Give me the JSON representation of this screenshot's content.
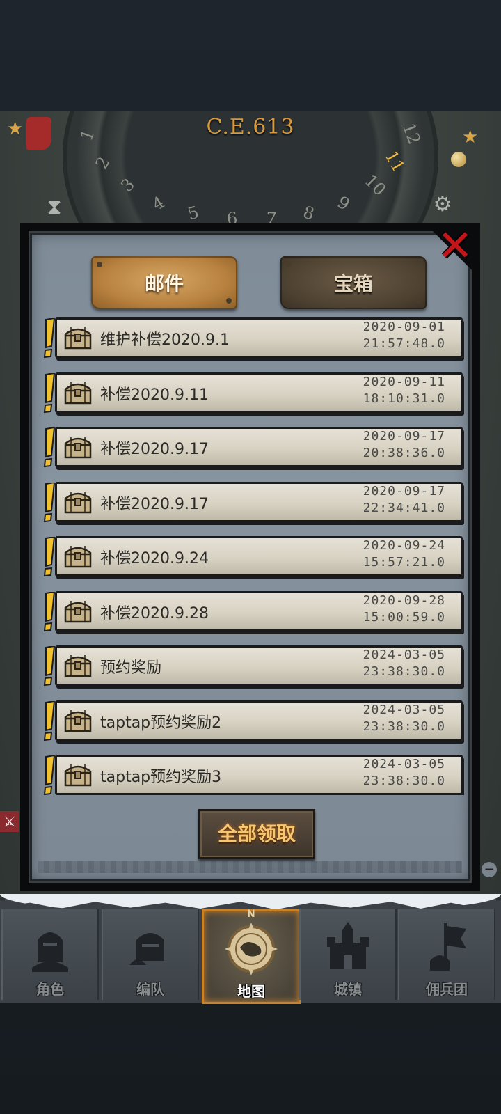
{
  "scene": {
    "era_label": "C.E.613",
    "dial_numbers": [
      "1",
      "2",
      "3",
      "4",
      "5",
      "6",
      "7",
      "8",
      "9",
      "10",
      "11",
      "12"
    ],
    "highlighted_number": "11"
  },
  "tabs": [
    {
      "label": "邮件",
      "active": true
    },
    {
      "label": "宝箱",
      "active": false
    }
  ],
  "mails": [
    {
      "title": "维护补偿2020.9.1",
      "date": "2020-09-01",
      "time": "21:57:48.0",
      "unread": true
    },
    {
      "title": "补偿2020.9.11",
      "date": "2020-09-11",
      "time": "18:10:31.0",
      "unread": true
    },
    {
      "title": "补偿2020.9.17",
      "date": "2020-09-17",
      "time": "20:38:36.0",
      "unread": true
    },
    {
      "title": "补偿2020.9.17",
      "date": "2020-09-17",
      "time": "22:34:41.0",
      "unread": true
    },
    {
      "title": "补偿2020.9.24",
      "date": "2020-09-24",
      "time": "15:57:21.0",
      "unread": true
    },
    {
      "title": "补偿2020.9.28",
      "date": "2020-09-28",
      "time": "15:00:59.0",
      "unread": true
    },
    {
      "title": "预约奖励",
      "date": "2024-03-05",
      "time": "23:38:30.0",
      "unread": true
    },
    {
      "title": "taptap预约奖励2",
      "date": "2024-03-05",
      "time": "23:38:30.0",
      "unread": true
    },
    {
      "title": "taptap预约奖励3",
      "date": "2024-03-05",
      "time": "23:38:30.0",
      "unread": true
    }
  ],
  "claim_all_label": "全部领取",
  "nav": [
    {
      "label": "角色",
      "icon": "knight-helmet-icon",
      "active": false
    },
    {
      "label": "编队",
      "icon": "party-helmet-icon",
      "active": false
    },
    {
      "label": "地图",
      "icon": "compass-map-icon",
      "active": true
    },
    {
      "label": "城镇",
      "icon": "castle-icon",
      "active": false
    },
    {
      "label": "佣兵团",
      "icon": "mercenary-banner-icon",
      "active": false
    }
  ],
  "colors": {
    "accent_gold": "#c9822a",
    "close_red": "#c3161b",
    "alert_yellow": "#f2c12e"
  }
}
